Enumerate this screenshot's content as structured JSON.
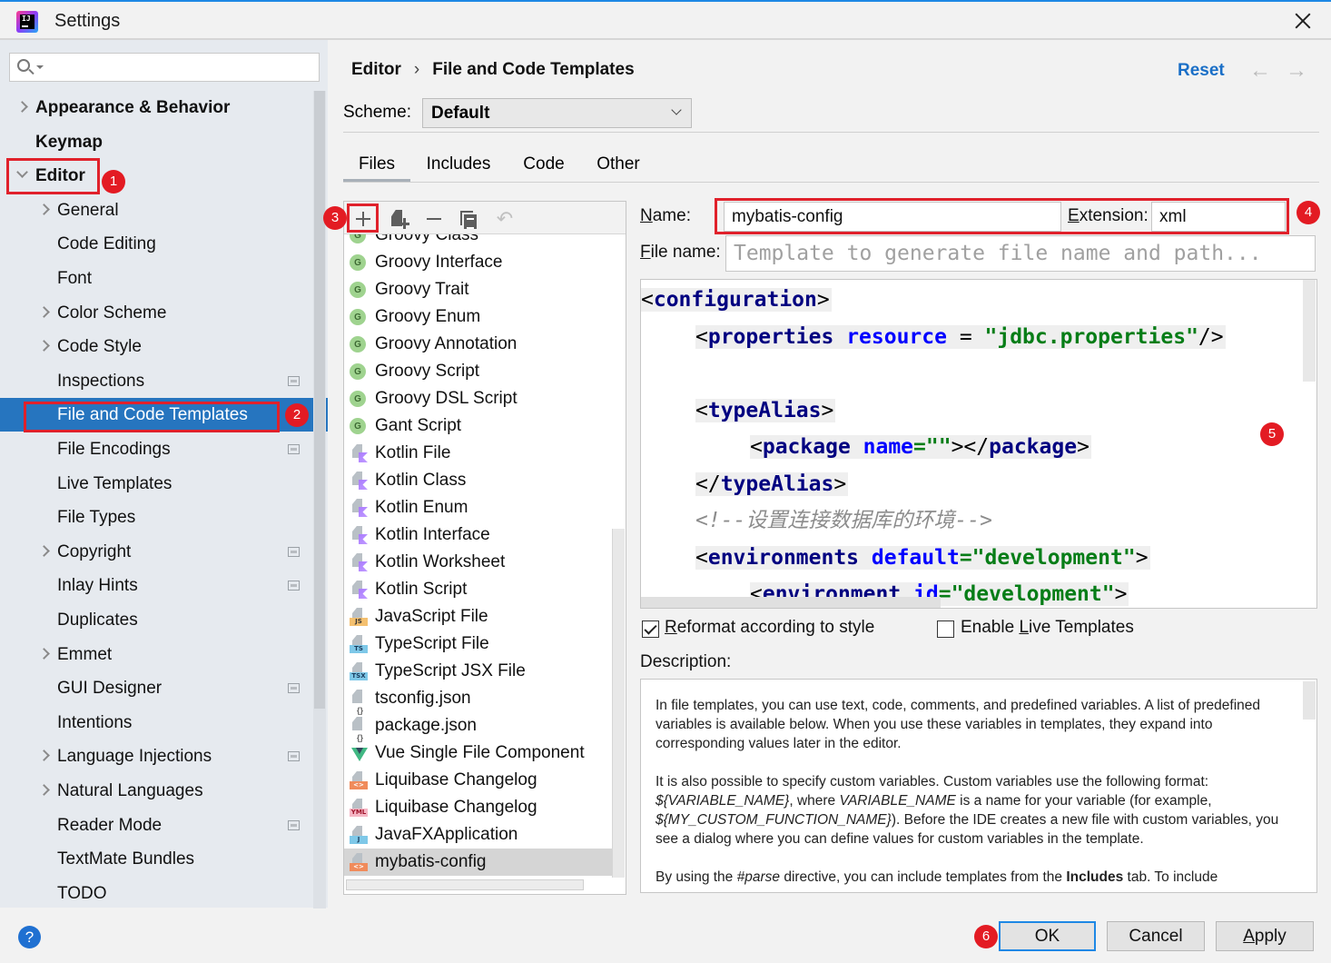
{
  "window": {
    "title": "Settings",
    "close_icon": "close-icon",
    "app_icon": "intellij-idea-icon"
  },
  "sidebar": {
    "search_placeholder": "",
    "items": [
      {
        "label": "Appearance & Behavior",
        "level": 0,
        "arrow": "right",
        "bold": true
      },
      {
        "label": "Keymap",
        "level": 0,
        "arrow": "none",
        "bold": true
      },
      {
        "label": "Editor",
        "level": 0,
        "arrow": "down",
        "bold": true
      },
      {
        "label": "General",
        "level": 1,
        "arrow": "right"
      },
      {
        "label": "Code Editing",
        "level": 1,
        "arrow": "none"
      },
      {
        "label": "Font",
        "level": 1,
        "arrow": "none"
      },
      {
        "label": "Color Scheme",
        "level": 1,
        "arrow": "right"
      },
      {
        "label": "Code Style",
        "level": 1,
        "arrow": "right"
      },
      {
        "label": "Inspections",
        "level": 1,
        "arrow": "none",
        "project_icon": true
      },
      {
        "label": "File and Code Templates",
        "level": 1,
        "arrow": "none",
        "selected": true
      },
      {
        "label": "File Encodings",
        "level": 1,
        "arrow": "none",
        "project_icon": true
      },
      {
        "label": "Live Templates",
        "level": 1,
        "arrow": "none"
      },
      {
        "label": "File Types",
        "level": 1,
        "arrow": "none"
      },
      {
        "label": "Copyright",
        "level": 1,
        "arrow": "right",
        "project_icon": true
      },
      {
        "label": "Inlay Hints",
        "level": 1,
        "arrow": "none",
        "project_icon": true
      },
      {
        "label": "Duplicates",
        "level": 1,
        "arrow": "none"
      },
      {
        "label": "Emmet",
        "level": 1,
        "arrow": "right"
      },
      {
        "label": "GUI Designer",
        "level": 1,
        "arrow": "none",
        "project_icon": true
      },
      {
        "label": "Intentions",
        "level": 1,
        "arrow": "none"
      },
      {
        "label": "Language Injections",
        "level": 1,
        "arrow": "right",
        "project_icon": true
      },
      {
        "label": "Natural Languages",
        "level": 1,
        "arrow": "right"
      },
      {
        "label": "Reader Mode",
        "level": 1,
        "arrow": "none",
        "project_icon": true
      },
      {
        "label": "TextMate Bundles",
        "level": 1,
        "arrow": "none"
      },
      {
        "label": "TODO",
        "level": 1,
        "arrow": "none"
      }
    ]
  },
  "header": {
    "breadcrumb": [
      "Editor",
      "File and Code Templates"
    ],
    "breadcrumb_separator": "›",
    "reset_label": "Reset",
    "back_icon": "←",
    "forward_icon": "→",
    "scheme_label": "Scheme:",
    "scheme_value": "Default"
  },
  "tabs": [
    {
      "label": "Files",
      "active": true
    },
    {
      "label": "Includes"
    },
    {
      "label": "Code"
    },
    {
      "label": "Other"
    }
  ],
  "toolbar": {
    "add": "add-icon",
    "copy_file": "create-child-template-icon",
    "remove": "remove-icon",
    "copy": "copy-icon",
    "reset": "undo-icon"
  },
  "templates": [
    {
      "label": "Groovy Class",
      "icon": "groovy"
    },
    {
      "label": "Groovy Interface",
      "icon": "groovy"
    },
    {
      "label": "Groovy Trait",
      "icon": "groovy"
    },
    {
      "label": "Groovy Enum",
      "icon": "groovy"
    },
    {
      "label": "Groovy Annotation",
      "icon": "groovy"
    },
    {
      "label": "Groovy Script",
      "icon": "groovy"
    },
    {
      "label": "Groovy DSL Script",
      "icon": "groovy"
    },
    {
      "label": "Gant Script",
      "icon": "groovy"
    },
    {
      "label": "Kotlin File",
      "icon": "kotlin"
    },
    {
      "label": "Kotlin Class",
      "icon": "kotlin"
    },
    {
      "label": "Kotlin Enum",
      "icon": "kotlin"
    },
    {
      "label": "Kotlin Interface",
      "icon": "kotlin"
    },
    {
      "label": "Kotlin Worksheet",
      "icon": "kotlin"
    },
    {
      "label": "Kotlin Script",
      "icon": "kotlin"
    },
    {
      "label": "JavaScript File",
      "icon": "tag",
      "tag": "JS",
      "tag_bg": "#f4c06f",
      "tag_fg": "#333"
    },
    {
      "label": "TypeScript File",
      "icon": "tag",
      "tag": "TS",
      "tag_bg": "#7ec8e8",
      "tag_fg": "#1b3b5c"
    },
    {
      "label": "TypeScript JSX File",
      "icon": "tag",
      "tag": "TSX",
      "tag_bg": "#7ec8e8",
      "tag_fg": "#1b3b5c"
    },
    {
      "label": "tsconfig.json",
      "icon": "json"
    },
    {
      "label": "package.json",
      "icon": "json"
    },
    {
      "label": "Vue Single File Component",
      "icon": "vue"
    },
    {
      "label": "Liquibase Changelog",
      "icon": "tag",
      "tag": "<>",
      "tag_bg": "#f08b5b",
      "tag_fg": "#fff"
    },
    {
      "label": "Liquibase Changelog",
      "icon": "tag",
      "tag": "YML",
      "tag_bg": "#f5b6c4",
      "tag_fg": "#a0122a"
    },
    {
      "label": "JavaFXApplication",
      "icon": "tag",
      "tag": "J",
      "tag_bg": "#7ec8e8",
      "tag_fg": "#1b3b5c"
    },
    {
      "label": "mybatis-config",
      "icon": "tag",
      "tag": "<>",
      "tag_bg": "#f08b5b",
      "tag_fg": "#fff",
      "selected": true
    }
  ],
  "form": {
    "name_label": "Name:",
    "name_value": "mybatis-config",
    "extension_label": "Extension:",
    "extension_value": "xml",
    "filename_label": "File name:",
    "filename_placeholder": "Template to generate file name and path...",
    "reformat_label": "Reformat according to style",
    "reformat_checked": true,
    "live_templates_label": "Enable Live Templates",
    "live_templates_checked": false,
    "description_label": "Description:"
  },
  "code": [
    {
      "indent": 0,
      "tokens": [
        [
          "p",
          "<"
        ],
        [
          "t",
          "configuration"
        ],
        [
          "p",
          ">"
        ]
      ]
    },
    {
      "indent": 1,
      "tokens": [
        [
          "p",
          "<"
        ],
        [
          "t",
          "properties "
        ],
        [
          "a",
          "resource "
        ],
        [
          "p",
          "= "
        ],
        [
          "s",
          "\"jdbc.properties\""
        ],
        [
          "p",
          "/>"
        ]
      ]
    },
    {
      "indent": 0,
      "tokens": []
    },
    {
      "indent": 1,
      "tokens": [
        [
          "p",
          "<"
        ],
        [
          "t",
          "typeAlias"
        ],
        [
          "p",
          ">"
        ]
      ]
    },
    {
      "indent": 2,
      "tokens": [
        [
          "p",
          "<"
        ],
        [
          "t",
          "package "
        ],
        [
          "a",
          "name"
        ],
        [
          "s",
          "=\"\""
        ],
        [
          "p",
          "></"
        ],
        [
          "t",
          "package"
        ],
        [
          "p",
          ">"
        ]
      ]
    },
    {
      "indent": 1,
      "tokens": [
        [
          "p",
          "</"
        ],
        [
          "t",
          "typeAlias"
        ],
        [
          "p",
          ">"
        ]
      ]
    },
    {
      "indent": 1,
      "tokens": [
        [
          "c",
          "<!--设置连接数据库的环境-->"
        ]
      ]
    },
    {
      "indent": 1,
      "tokens": [
        [
          "p",
          "<"
        ],
        [
          "t",
          "environments "
        ],
        [
          "a",
          "default"
        ],
        [
          "s",
          "=\"development\""
        ],
        [
          "p",
          ">"
        ]
      ]
    },
    {
      "indent": 2,
      "tokens": [
        [
          "p",
          "<"
        ],
        [
          "t",
          "environment "
        ],
        [
          "a",
          "id"
        ],
        [
          "s",
          "=\"development\""
        ],
        [
          "p",
          ">"
        ]
      ]
    }
  ],
  "description": {
    "p1": "In file templates, you can use text, code, comments, and predefined variables. A list of predefined variables is available below. When you use these variables in templates, they expand into corresponding values later in the editor.",
    "p2_a": "It is also possible to specify custom variables. Custom variables use the following format: ",
    "p2_var1": "${VARIABLE_NAME}",
    "p2_b": ", where ",
    "p2_var2": "VARIABLE_NAME",
    "p2_c": " is a name for your variable (for example, ",
    "p2_var3": "${MY_CUSTOM_FUNCTION_NAME}",
    "p2_d": "). Before the IDE creates a new file with custom variables, you see a dialog where you can define values for custom variables in the template.",
    "p3_a": "By using the ",
    "p3_parse": "#parse",
    "p3_b": " directive, you can include templates from the ",
    "p3_includes": "Includes",
    "p3_c": " tab. To include"
  },
  "annotations": [
    "1",
    "2",
    "3",
    "4",
    "5",
    "6"
  ],
  "footer": {
    "help": "?",
    "ok": "OK",
    "cancel": "Cancel",
    "apply": "Apply"
  },
  "colors": {
    "accent": "#2675bf",
    "link": "#1a6fc7",
    "annotation_red": "#e31b23"
  }
}
